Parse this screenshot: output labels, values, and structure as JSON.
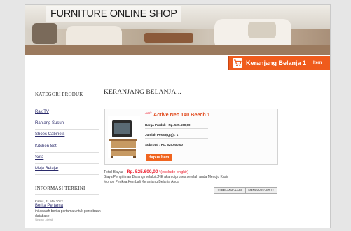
{
  "header": {
    "title": "FURNITURE ONLINE SHOP"
  },
  "cart": {
    "label": "Keranjang Belanja",
    "count": "1",
    "unit": "Item"
  },
  "sidebar": {
    "category_heading": "KATEGORI PRODUK",
    "categories": [
      "Rak TV",
      "Ranjang Susun",
      "Shoes Cabinets",
      "Kitchen Set",
      "Sofa",
      "Meja Belajar"
    ],
    "news_heading": "INFORMASI TERKINI",
    "news": {
      "date": "Kamis, 31 Mei 2012",
      "title": "Berita Pertama",
      "body": "ini adalah berita pertama untuk percobaan database",
      "more": "Simpan - detail"
    }
  },
  "main": {
    "title": "KERANJANG BELANJA...",
    "item": {
      "badge": "Activ",
      "name": "Active Neo 140 Beech 1",
      "price": "Harga Produk : Rp. 525.600,00",
      "qty": "Jumlah Pesan(Qty) : 1",
      "subtotal": "SubTotal : Rp. 525.600,00",
      "delete_label": "Hapus Item"
    },
    "total_label": "Total Bayar :",
    "total_amount": "Rp. 525.600,00",
    "total_note": "*(exclude ongkir)",
    "info_line1": "Biaya Pengiriman Barang melalui JNE akan diproses setelah anda Menuju Kasir",
    "info_line2": "Mohon Periksa Kembali Keranjang Belanja Anda",
    "back_label": "<< BELANJA LAGI",
    "checkout_label": "MENUJU KASIR >>"
  },
  "colors": {
    "accent": "#ef5b1c",
    "link": "#2a2a6a",
    "price_red": "#e22233"
  }
}
